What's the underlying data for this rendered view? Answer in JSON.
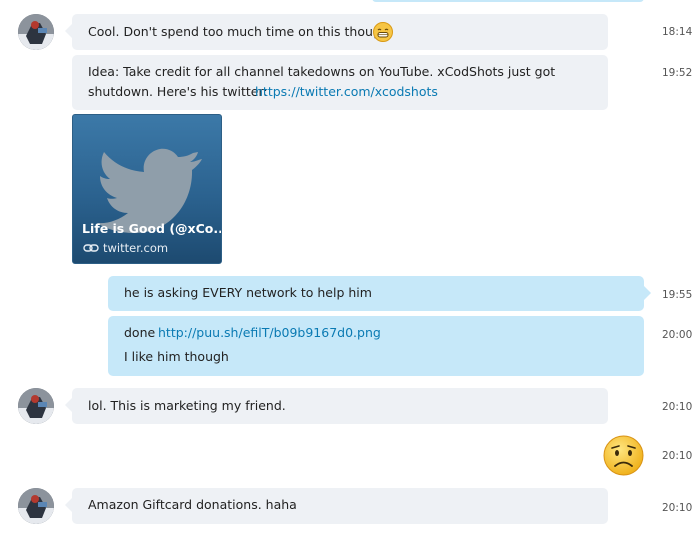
{
  "messages": {
    "m1": {
      "text": "Cool. Don't spend too much time on this though",
      "time": "18:14"
    },
    "m2": {
      "line1": "Idea: Take credit for all channel takedowns on YouTube. xCodShots just got",
      "line2_prefix": "shutdown. Here's his twitter: ",
      "link": "https://twitter.com/xcodshots",
      "time": "19:52"
    },
    "card": {
      "title": "Life is Good (@xCo...",
      "domain": "twitter.com"
    },
    "m3": {
      "text": "he is asking EVERY network to help him",
      "time": "19:55"
    },
    "m4": {
      "prefix": "done ",
      "link": "http://puu.sh/efilT/b09b9167d0.png",
      "line2": "I like him though",
      "time": "20:00"
    },
    "m5": {
      "text": "lol. This is marketing my friend.",
      "time": "20:10"
    },
    "m6": {
      "emoticon": "worried-face-emoticon",
      "time": "20:10"
    },
    "m7": {
      "text": "Amazon Giftcard donations. haha",
      "time": "20:10"
    }
  },
  "colors": {
    "incoming_bubble": "#eef1f5",
    "outgoing_bubble": "#c6e8f9",
    "link": "#0a7ab3",
    "emoji": "#f6c544"
  }
}
